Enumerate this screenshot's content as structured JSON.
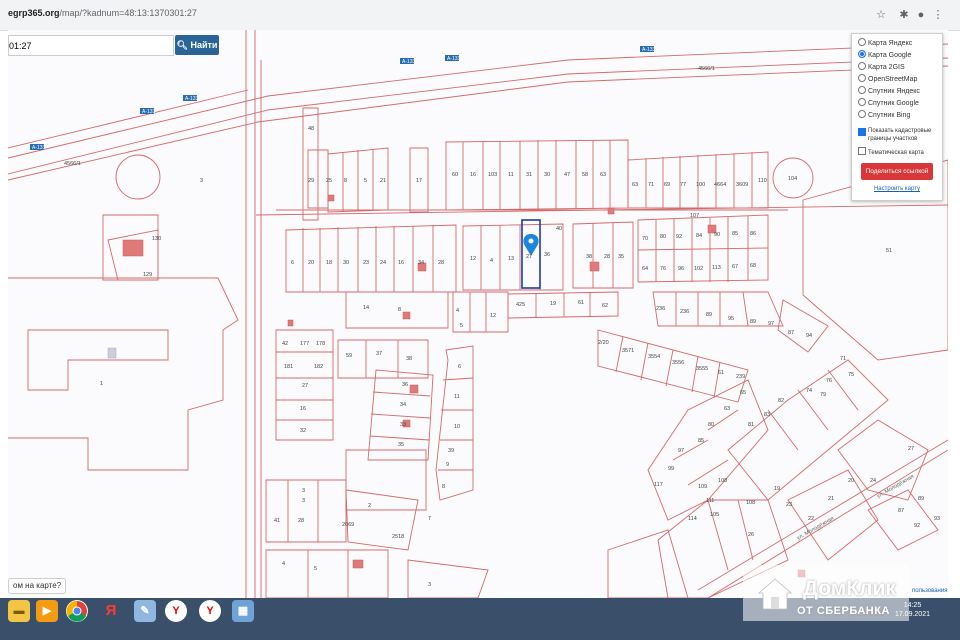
{
  "browser": {
    "url_domain": "egrp365.org",
    "url_path": "/map/?kadnum=48:13:1370301:27",
    "icons": [
      "star-icon",
      "extensions-icon",
      "profile-icon",
      "menu-icon"
    ]
  },
  "search": {
    "value": "01:27",
    "button_label": "Найти"
  },
  "layers_panel": {
    "options": [
      {
        "label": "Карта Яндекс",
        "selected": false
      },
      {
        "label": "Карта Google",
        "selected": true
      },
      {
        "label": "Карта 2GIS",
        "selected": false
      },
      {
        "label": "OpenStreetMap",
        "selected": false
      },
      {
        "label": "Спутник Яндекс",
        "selected": false
      },
      {
        "label": "Спутник Google",
        "selected": false
      },
      {
        "label": "Спутник Bing",
        "selected": false
      }
    ],
    "check_boundaries": "Показать кадастровые границы участков",
    "check_thematic": "Тематическая карта",
    "share_button": "Поделиться ссылкой",
    "setup_link": "Настроить карту"
  },
  "map": {
    "road_labels": [
      "А-133",
      "А-133",
      "А-133",
      "А-133",
      "А-133",
      "А-133",
      "4566/1"
    ],
    "street_label": "ул. Молодёжная",
    "parcel_numbers": {
      "top_row": [
        "29",
        "25",
        "8",
        "5",
        "21",
        "17",
        "60",
        "16",
        "103",
        "11",
        "31",
        "30",
        "47",
        "58",
        "63",
        "71",
        "69",
        "77",
        "100",
        "4664",
        "3609",
        "110"
      ],
      "second_row": [
        "6",
        "20",
        "18",
        "30",
        "23",
        "24",
        "16",
        "34",
        "28",
        "12",
        "4",
        "13",
        "27",
        "36",
        "30",
        "28",
        "35",
        "70",
        "80",
        "92",
        "84",
        "90",
        "85",
        "86"
      ],
      "right_row": [
        "64",
        "76",
        "96",
        "102",
        "113",
        "67",
        "68"
      ],
      "middle": [
        "14",
        "8",
        "4",
        "5",
        "12",
        "425",
        "19",
        "61",
        "62",
        "42",
        "177",
        "178",
        "181",
        "182",
        "27",
        "16",
        "32",
        "59",
        "37",
        "38",
        "36",
        "34",
        "33",
        "35",
        "6",
        "11",
        "10",
        "39",
        "9",
        "8",
        "7"
      ],
      "lower": [
        "3",
        "2",
        "41",
        "28",
        "2069",
        "2518",
        "4",
        "5",
        "3",
        "1",
        "48",
        "130",
        "129",
        "3",
        "104",
        "51",
        "107"
      ],
      "right_lower": [
        "236",
        "89",
        "95",
        "97",
        "94",
        "2/20",
        "3571",
        "3554",
        "3556",
        "3555",
        "61",
        "239",
        "71",
        "75",
        "76",
        "74",
        "79",
        "82",
        "83",
        "81",
        "63",
        "65",
        "85",
        "80",
        "117",
        "109",
        "108",
        "111",
        "114",
        "105",
        "108",
        "26",
        "19",
        "23",
        "22",
        "21",
        "20",
        "24",
        "27",
        "87",
        "89",
        "92",
        "93"
      ]
    },
    "highlighted_parcel": "27"
  },
  "hint": "ом на карте?",
  "taskbar": {
    "apps": [
      "folder-icon",
      "media-player-icon",
      "chrome-icon",
      "yandex-browser-icon",
      "paint-icon",
      "yandex-icon",
      "yandex-icon",
      "photos-icon"
    ],
    "time": "14:25",
    "date": "17.09.2021"
  },
  "watermark": {
    "line1": "ДомКлик",
    "line2": "ОТ СБЕРБАНКА"
  },
  "attribution": "пользования"
}
